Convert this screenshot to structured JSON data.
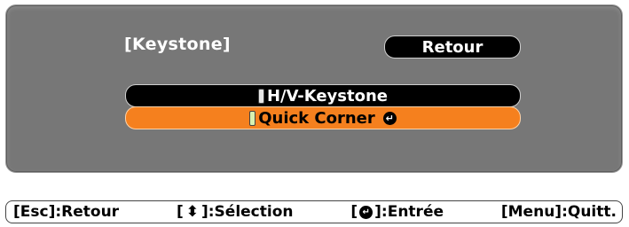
{
  "menu": {
    "title": "[Keystone]",
    "back_label": "Retour",
    "items": [
      {
        "label": "H/V-Keystone",
        "selected": false
      },
      {
        "label": "Quick Corner",
        "selected": true,
        "icon": "enter-icon"
      }
    ]
  },
  "help_bar": {
    "esc_key": "[Esc]",
    "esc_label": ":Retour",
    "select_open": "[",
    "select_icon": "up-down-arrow-icon",
    "select_close": "]",
    "select_label": ":Sélection",
    "enter_open": "[",
    "enter_icon": "enter-icon",
    "enter_close": "]",
    "enter_label": ":Entrée",
    "menu_key": "[Menu]",
    "menu_label": ":Quitt."
  },
  "colors": {
    "panel": "#777777",
    "selected_item": "#f5801e",
    "item": "#000000"
  }
}
